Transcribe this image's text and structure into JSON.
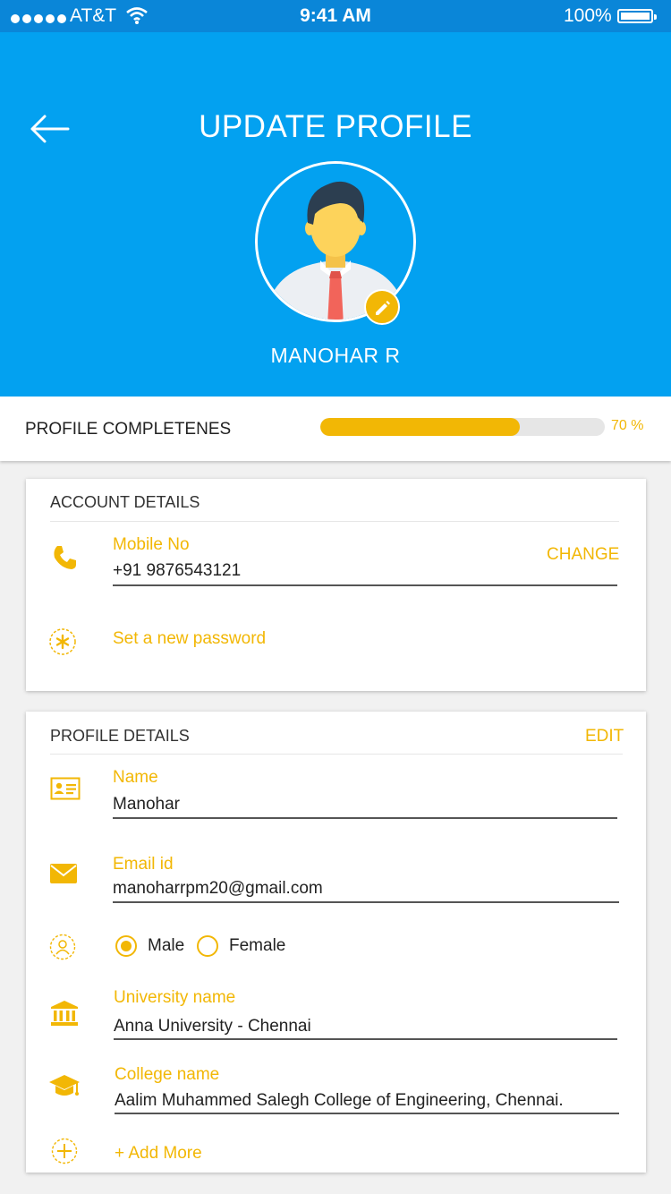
{
  "status_bar": {
    "carrier": "AT&T",
    "time": "9:41 AM",
    "battery": "100%"
  },
  "header": {
    "title": "UPDATE PROFILE",
    "user_name": "MANOHAR R"
  },
  "completeness": {
    "label": "PROFILE COMPLETENES",
    "percent_label": "70 %",
    "value": 0.7
  },
  "account": {
    "title": "ACCOUNT DETAILS",
    "mobile_label": "Mobile No",
    "mobile_value": "+91 9876543121",
    "change_label": "CHANGE",
    "password_link": "Set a new password"
  },
  "profile": {
    "title": "PROFILE DETAILS",
    "edit_label": "EDIT",
    "name_label": "Name",
    "name_value": "Manohar",
    "email_label": "Email id",
    "email_value": "manoharrpm20@gmail.com",
    "gender_options": [
      "Male",
      "Female"
    ],
    "gender_selected": "Male",
    "university_label": "University name",
    "university_value": "Anna University - Chennai",
    "college_label": "College name",
    "college_value": "Aalim Muhammed Salegh College of Engineering, Chennai.",
    "add_more": "+ Add More"
  },
  "colors": {
    "header_blue": "#03a1f0",
    "accent_gold": "#f2b705"
  },
  "icons": [
    "signal-dots-icon",
    "wifi-icon",
    "battery-icon",
    "back-arrow-icon",
    "avatar-illustration",
    "pencil-icon",
    "phone-icon",
    "asterisk-icon",
    "id-card-icon",
    "envelope-icon",
    "person-icon",
    "bank-icon",
    "graduation-cap-icon",
    "plus-circle-icon"
  ]
}
